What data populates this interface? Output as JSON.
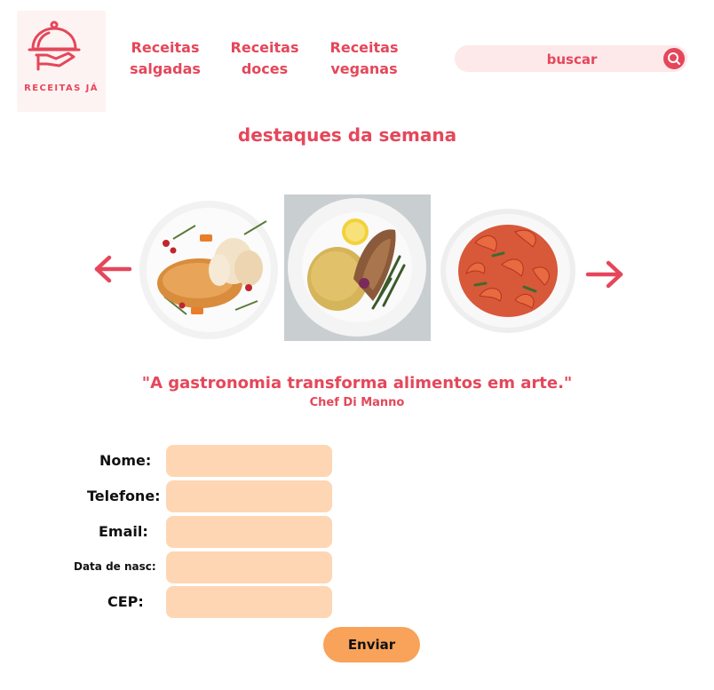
{
  "brand": {
    "logo_text": "RECEITAS JÁ"
  },
  "nav": [
    {
      "line1": "Receitas",
      "line2": "salgadas"
    },
    {
      "line1": "Receitas",
      "line2": "doces"
    },
    {
      "line1": "Receitas",
      "line2": "veganas"
    }
  ],
  "search": {
    "placeholder": "buscar"
  },
  "highlights": {
    "title": "destaques da semana",
    "dishes": [
      "roast-turkey-image",
      "fish-rice-plate-image",
      "shrimp-bowl-image"
    ]
  },
  "quote": {
    "text": "\"A gastronomia transforma alimentos em arte.\"",
    "author": "Chef Di Manno"
  },
  "form": {
    "labels": {
      "name": "Nome:",
      "phone": "Telefone:",
      "email": "Email:",
      "birth": "Data de nasc:",
      "cep": "CEP:"
    },
    "submit_label": "Enviar"
  },
  "colors": {
    "accent": "#e5475a",
    "search_bg": "#fde8ea",
    "field_bg": "#fed6b3",
    "button_bg": "#f8a25a"
  }
}
